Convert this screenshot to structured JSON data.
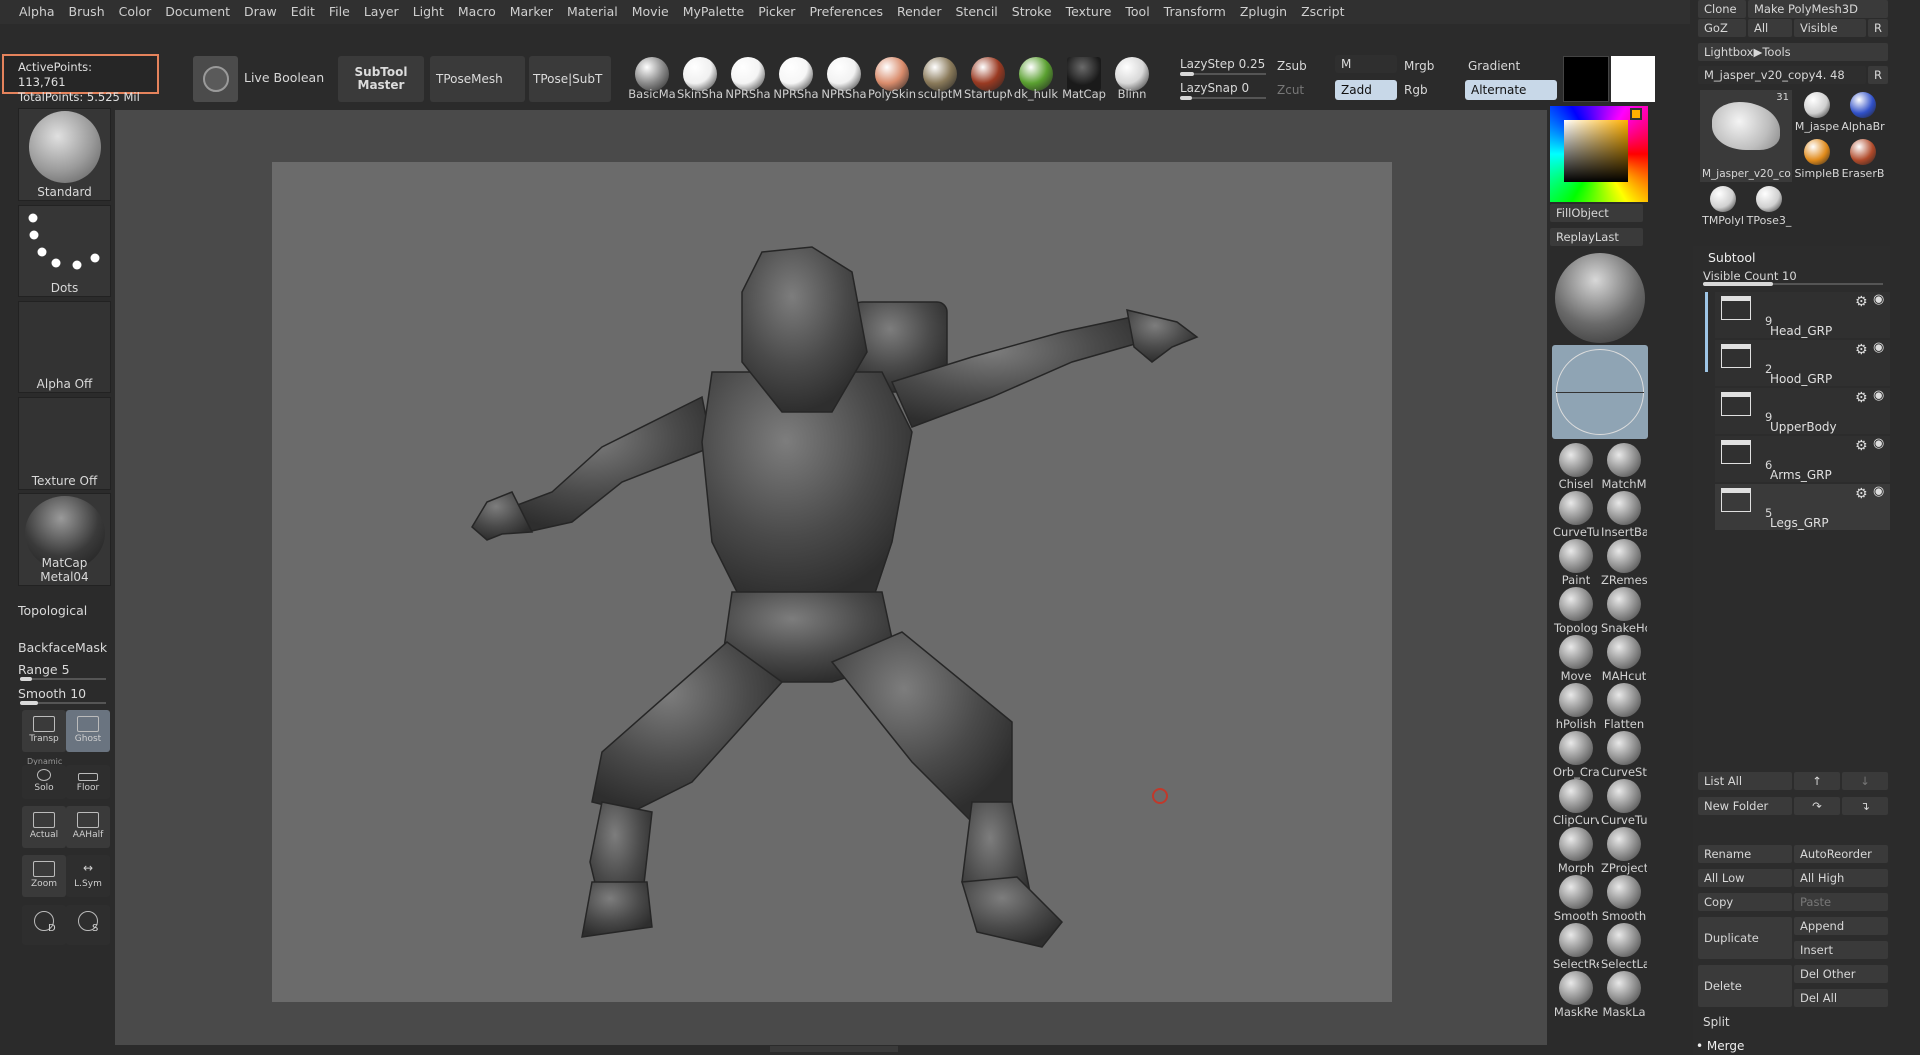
{
  "menu": [
    "Alpha",
    "Brush",
    "Color",
    "Document",
    "Draw",
    "Edit",
    "File",
    "Layer",
    "Light",
    "Macro",
    "Marker",
    "Material",
    "Movie",
    "MyPalette",
    "Picker",
    "Preferences",
    "Render",
    "Stencil",
    "Stroke",
    "Texture",
    "Tool",
    "Transform",
    "Zplugin",
    "Zscript"
  ],
  "points": {
    "active": "ActivePoints: 113,761",
    "total": "TotalPoints: 5.525 Mil"
  },
  "toolbar": {
    "live_boolean": "Live Boolean",
    "subtool_master_l1": "SubTool",
    "subtool_master_l2": "Master",
    "tposemesh": "TPoseMesh",
    "tpose_subt": "TPose|SubT",
    "materials": [
      "BasicMa",
      "SkinSha",
      "NPRSha",
      "NPRSha",
      "NPRSha",
      "PolySkin",
      "sculptM",
      "StartupM",
      "dk_hulk",
      "MatCap",
      "Blinn"
    ],
    "lazystep": "LazyStep 0.25",
    "lazysnap": "LazySnap 0",
    "zsub": "Zsub",
    "zcut": "Zcut",
    "zadd": "Zadd",
    "m": "M",
    "mrgb": "Mrgb",
    "rgb": "Rgb",
    "gradient": "Gradient",
    "alternate": "Alternate"
  },
  "left_shelf": {
    "brush": "Standard",
    "stroke": "Dots",
    "alpha": "Alpha Off",
    "texture": "Texture Off",
    "material": "MatCap Metal04",
    "topological": "Topological",
    "backfacemask": "BackfaceMask",
    "range": "Range 5",
    "smooth": "Smooth 10",
    "transp": "Transp",
    "ghost": "Ghost",
    "dynamic": "Dynamic",
    "solo": "Solo",
    "floor": "Floor",
    "actual": "Actual",
    "aahalf": "AAHalf",
    "zoom": "Zoom",
    "lsym": "L.Sym",
    "d_label": "D",
    "s_label": "S"
  },
  "color_panel": {
    "fillobject": "FillObject",
    "replaylast": "ReplayLast"
  },
  "brushes": [
    [
      "Chisel",
      "MatchM"
    ],
    [
      "CurveTu",
      "InsertBa"
    ],
    [
      "Paint",
      "ZRemes"
    ],
    [
      "Topolog",
      "SnakeHo"
    ],
    [
      "Move",
      "MAHcut"
    ],
    [
      "hPolish",
      "Flatten"
    ],
    [
      "Orb_Cra",
      "CurveSt"
    ],
    [
      "ClipCurv",
      "CurveTu"
    ],
    [
      "Morph",
      "ZProject"
    ],
    [
      "Smooth",
      "Smooth"
    ],
    [
      "SelectRe",
      "SelectLa"
    ],
    [
      "MaskRe",
      "MaskLa"
    ]
  ],
  "right_panel": {
    "clone": "Clone",
    "make_polymesh": "Make PolyMesh3D",
    "goz": "GoZ",
    "all": "All",
    "visible": "Visible",
    "r": "R",
    "lightbox_tools": "Lightbox▶Tools",
    "tool_name": "M_jasper_v20_copy4. 48",
    "thumb_count": "31",
    "thumb_main": "M_jasper_v20_co",
    "thumbs": [
      "M_jaspe",
      "AlphaBr",
      "SimpleB",
      "EraserB",
      "TMPolyl",
      "TPose3_"
    ],
    "subtool": "Subtool",
    "visible_count": "Visible Count 10",
    "subtools": [
      {
        "count": "9",
        "name": "Head_GRP"
      },
      {
        "count": "2",
        "name": "Hood_GRP"
      },
      {
        "count": "9",
        "name": "UpperBody"
      },
      {
        "count": "6",
        "name": "Arms_GRP"
      },
      {
        "count": "5",
        "name": "Legs_GRP"
      }
    ],
    "list_all": "List All",
    "new_folder": "New Folder",
    "rename": "Rename",
    "autoreorder": "AutoReorder",
    "all_low": "All Low",
    "all_high": "All High",
    "copy": "Copy",
    "paste": "Paste",
    "append": "Append",
    "duplicate": "Duplicate",
    "insert": "Insert",
    "delete": "Delete",
    "del_other": "Del Other",
    "del_all": "Del All",
    "split": "Split",
    "merge": "Merge"
  }
}
